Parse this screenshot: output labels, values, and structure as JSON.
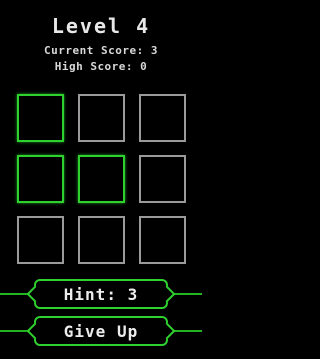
{
  "header": {
    "level": "Level 4",
    "current_score": "Current Score: 3",
    "high_score": "High Score: 0"
  },
  "board": {
    "rows": 3,
    "cols": 3,
    "lit_color": "#2fd12f",
    "unlit_color": "#9a9a9a",
    "tiles": [
      {
        "lit": true
      },
      {
        "lit": false
      },
      {
        "lit": false
      },
      {
        "lit": true
      },
      {
        "lit": true
      },
      {
        "lit": false
      },
      {
        "lit": false
      },
      {
        "lit": false
      },
      {
        "lit": false
      }
    ]
  },
  "controls": {
    "hint_label": "Hint: 3",
    "give_up_label": "Give Up",
    "accent_color": "#2fd12f"
  }
}
